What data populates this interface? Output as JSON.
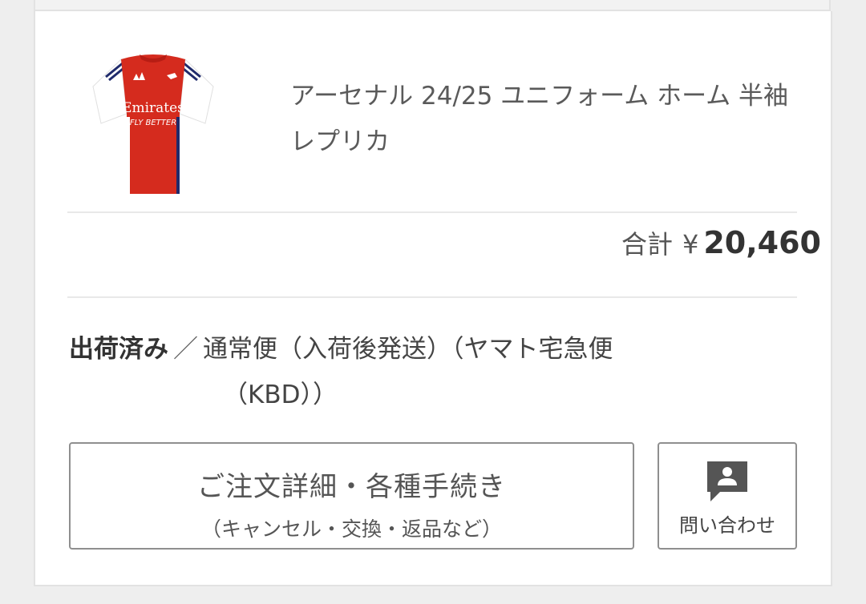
{
  "product": {
    "name": "アーセナル 24/25 ユニフォーム ホーム 半袖 レプリカ",
    "shirt_sponsor_line1": "Emirates",
    "shirt_sponsor_line2": "FLY BETTER",
    "colors": {
      "shirt_red": "#d52b1e",
      "sleeve_white": "#ffffff",
      "trim_navy": "#1f2a6b"
    }
  },
  "total": {
    "label": "合計",
    "currency": "¥",
    "amount": "20,460"
  },
  "status": {
    "main": "出荷済み",
    "separator": "／",
    "shipping_line1": "通常便（入荷後発送）（ヤマト宅急便",
    "shipping_line2": "（KBD））"
  },
  "actions": {
    "detail_label": "ご注文詳細・各種手続き",
    "detail_sublabel": "（キャンセル・交換・返品など）",
    "contact_label": "問い合わせ",
    "contact_icon": "contact-person-icon"
  }
}
